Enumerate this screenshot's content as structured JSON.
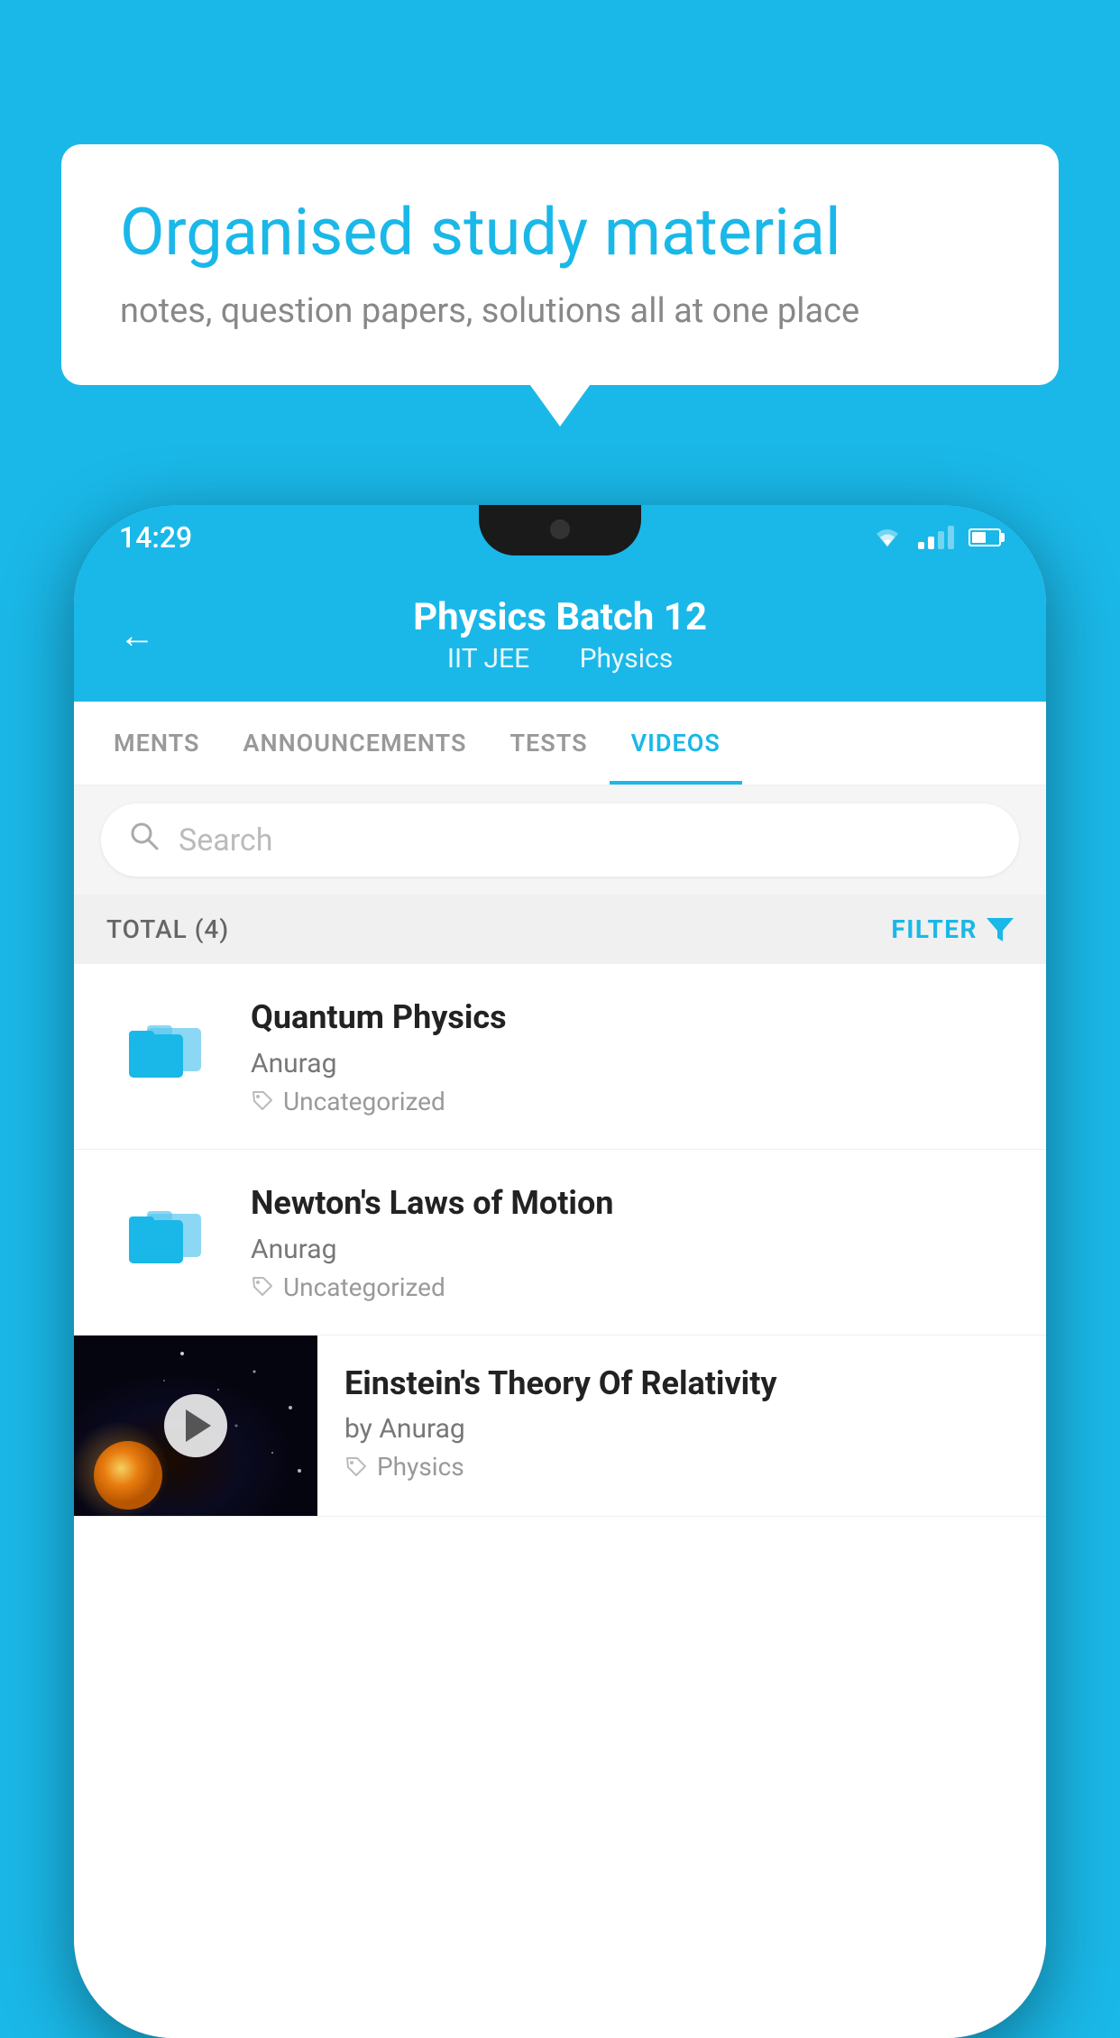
{
  "background_color": "#1ab8e8",
  "bubble": {
    "title": "Organised study material",
    "subtitle": "notes, question papers, solutions all at one place"
  },
  "phone": {
    "status_bar": {
      "time": "14:29",
      "wifi": "▼",
      "signal": "signal",
      "battery": "battery"
    },
    "header": {
      "title": "Physics Batch 12",
      "subtitle_part1": "IIT JEE",
      "subtitle_part2": "Physics",
      "back_label": "←"
    },
    "tabs": [
      {
        "label": "MENTS",
        "active": false
      },
      {
        "label": "ANNOUNCEMENTS",
        "active": false
      },
      {
        "label": "TESTS",
        "active": false
      },
      {
        "label": "VIDEOS",
        "active": true
      }
    ],
    "search": {
      "placeholder": "Search"
    },
    "filter_row": {
      "total": "TOTAL (4)",
      "filter_label": "FILTER"
    },
    "videos": [
      {
        "title": "Quantum Physics",
        "author": "Anurag",
        "tag": "Uncategorized",
        "type": "folder"
      },
      {
        "title": "Newton's Laws of Motion",
        "author": "Anurag",
        "tag": "Uncategorized",
        "type": "folder"
      },
      {
        "title": "Einstein's Theory Of Relativity",
        "author": "by Anurag",
        "tag": "Physics",
        "type": "thumbnail"
      }
    ]
  }
}
